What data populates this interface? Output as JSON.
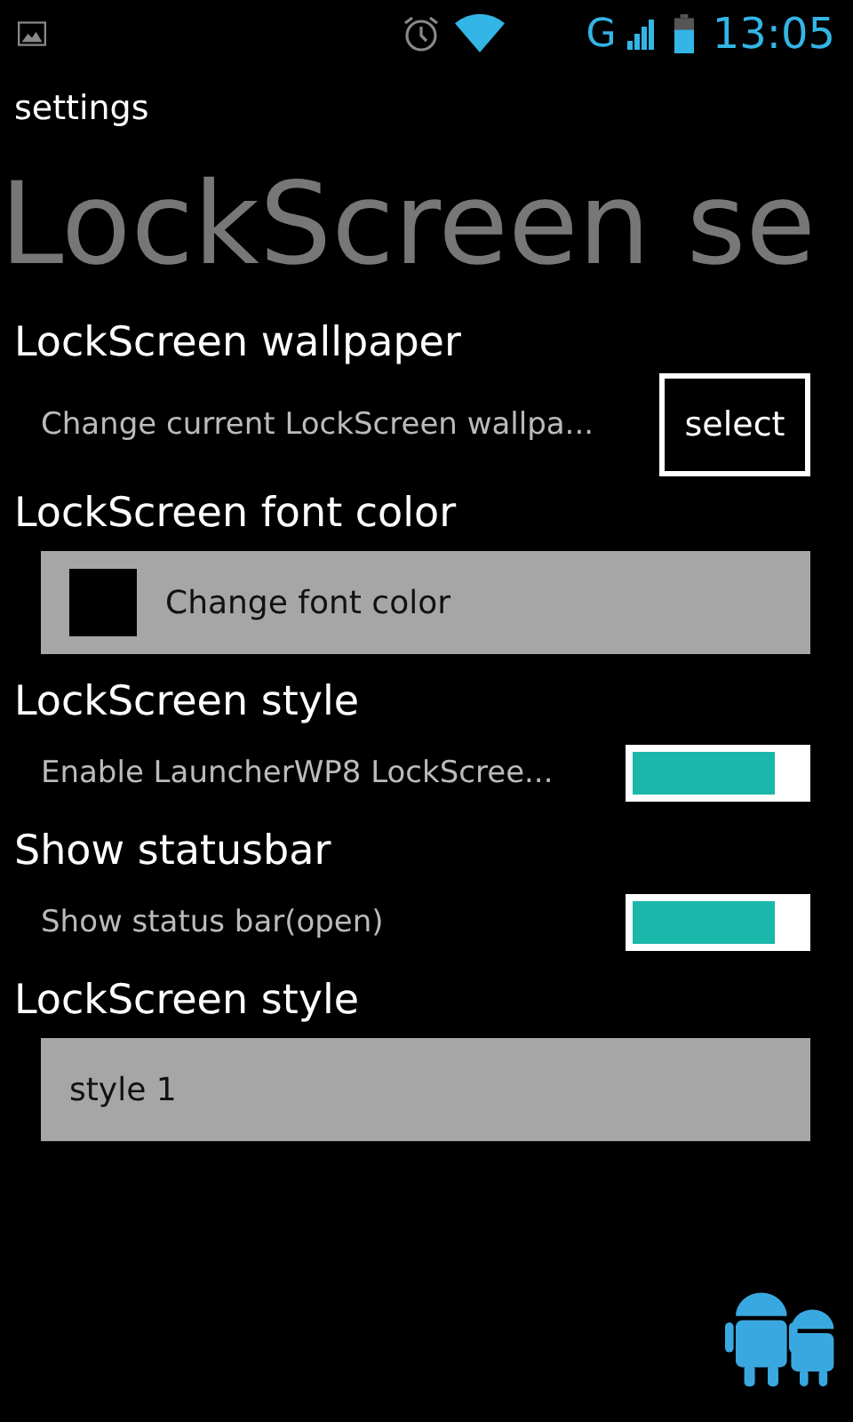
{
  "status_bar": {
    "network": "G",
    "time": "13:05"
  },
  "header": {
    "title": "settings"
  },
  "page_title": "LockScreen se",
  "sections": [
    {
      "kind": "button",
      "title": "LockScreen wallpaper",
      "summary": "Change current LockScreen wallpa...",
      "button": "select"
    },
    {
      "kind": "color",
      "title": "LockScreen font color",
      "label": "Change font color",
      "color": "#000000"
    },
    {
      "kind": "toggle",
      "title": "LockScreen style",
      "summary": "Enable LauncherWP8 LockScree...",
      "on": true
    },
    {
      "kind": "toggle",
      "title": "Show statusbar",
      "summary": "Show status bar(open)",
      "on": true
    },
    {
      "kind": "dropdown",
      "title": "LockScreen style",
      "value": "style 1"
    }
  ]
}
